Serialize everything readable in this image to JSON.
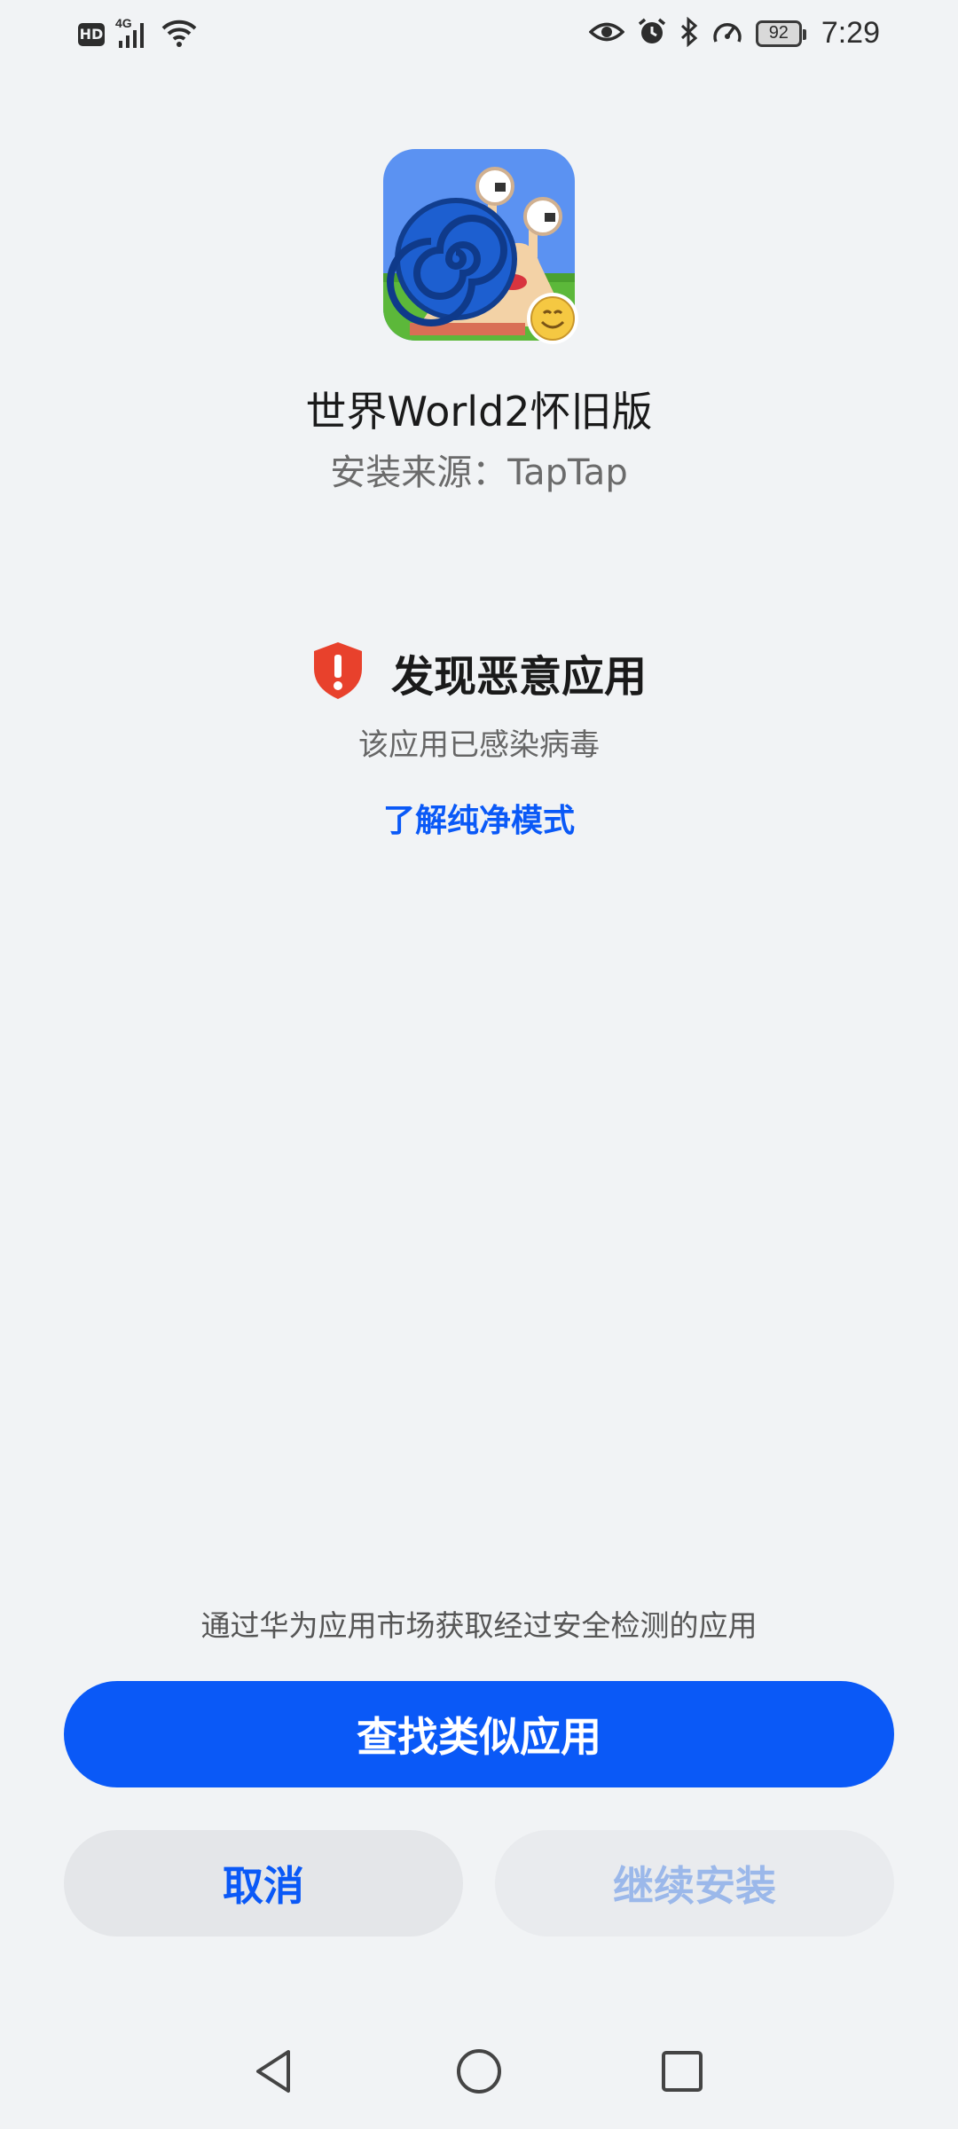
{
  "status_bar": {
    "hd_label": "HD",
    "network_label": "4G",
    "battery_level": "92",
    "time": "7:29",
    "icons": [
      "hd-icon",
      "signal-icon",
      "wifi-icon",
      "eye-icon",
      "alarm-icon",
      "bluetooth-icon",
      "speedometer-icon",
      "battery-icon"
    ]
  },
  "app": {
    "icon": "snail-app-icon",
    "badge_icon": "taptap-source-badge-icon",
    "name": "世界World2怀旧版",
    "install_source": "安装来源：TapTap"
  },
  "warning": {
    "icon": "shield-alert-icon",
    "icon_color": "#e8412c",
    "title": "发现恶意应用",
    "description": "该应用已感染病毒",
    "learn_more_link": "了解纯净模式"
  },
  "footer": {
    "hint": "通过华为应用市场获取经过安全检测的应用",
    "find_similar_label": "查找类似应用",
    "cancel_label": "取消",
    "continue_install_label": "继续安装",
    "accent_color": "#0a59f7"
  },
  "nav_bar": {
    "icons": [
      "back-icon",
      "home-icon",
      "recents-icon"
    ]
  }
}
